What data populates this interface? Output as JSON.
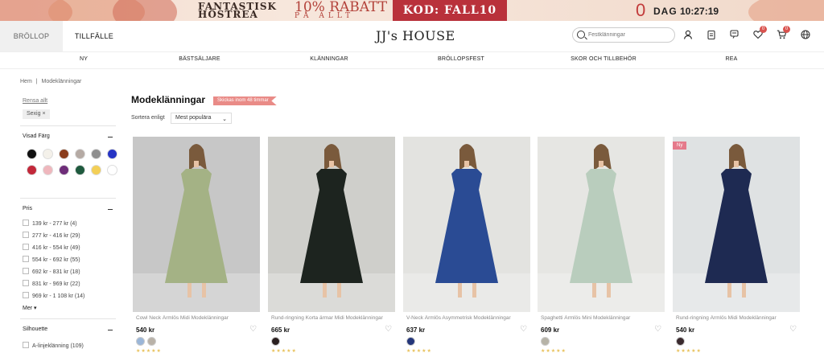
{
  "promo": {
    "line1": "FANTASTISK",
    "line2": "HÖSTREA",
    "rabatt_top": "10% RABATT",
    "rabatt_bottom": "PÅ ALLT",
    "code": "KOD: FALL10",
    "count": "0",
    "day": "DAG",
    "time": "10:27:19"
  },
  "header": {
    "tabs": [
      "BRÖLLOP",
      "TILLFÄLLE"
    ],
    "logo": "JJ's HOUSE",
    "search_placeholder": "Festklänningar",
    "wishlist_badge": "0",
    "cart_badge": "0"
  },
  "nav": [
    "NY",
    "BÄSTSÄLJARE",
    "KLÄNNINGAR",
    "BRÖLLOPSFEST",
    "SKOR OCH TILLBEHÖR",
    "REA"
  ],
  "breadcrumb": {
    "home": "Hem",
    "sep": "|",
    "current": "Modeklänningar"
  },
  "sidebar": {
    "clear_all": "Rensa allt",
    "active_filter": "Sexig ×",
    "color_title": "Visad Färg",
    "colors": [
      "#111111",
      "#f4f1ea",
      "#8a3d1c",
      "#b5aaa4",
      "#8f8f8f",
      "#2634c4",
      "#c2283a",
      "#efb7bd",
      "#6e2d79",
      "#1f5a3e",
      "#f3cf57",
      "#ffffff"
    ],
    "price_title": "Pris",
    "prices": [
      "139 kr - 277 kr (4)",
      "277 kr - 416 kr (29)",
      "416 kr - 554 kr (49)",
      "554 kr - 692 kr (55)",
      "692 kr - 831 kr (18)",
      "831 kr - 969 kr (22)",
      "969 kr - 1 108 kr (14)"
    ],
    "more": "Mer ▾",
    "silhouette_title": "Silhouette",
    "silhouette_first": "A-linjeklänning (109)"
  },
  "main": {
    "title": "Modeklänningar",
    "ship_tag": "Skickas inom 48 timmar",
    "sort_label": "Sortera enligt",
    "sort_value": "Mest populära"
  },
  "products": [
    {
      "name": "Cowl Neck Ärmlös Midi Modeklänningar",
      "price": "540 kr",
      "dress": "#a4b285",
      "bg": "#c7c7c7",
      "dots": [
        "#9bb6d8",
        "#b9b2a8"
      ],
      "new": ""
    },
    {
      "name": "Rund-ringning Korta ärmar Midi Modeklänningar",
      "price": "665 kr",
      "dress": "#1d241f",
      "bg": "#cfcfcb",
      "dots": [
        "#2a1f1f"
      ],
      "new": ""
    },
    {
      "name": "V-Neck Ärmlös Asymmetrisk Modeklänningar",
      "price": "637 kr",
      "dress": "#2a4b94",
      "bg": "#e3e3e0",
      "dots": [
        "#24367a"
      ],
      "new": ""
    },
    {
      "name": "Spaghetti Ärmlös Mini Modeklänningar",
      "price": "609 kr",
      "dress": "#b9cdbd",
      "bg": "#e6e6e3",
      "dots": [
        "#b6b3a7"
      ],
      "new": ""
    },
    {
      "name": "Rund-ringning Ärmlös Midi Modeklänningar",
      "price": "540 kr",
      "dress": "#1e2a52",
      "bg": "#dfe2e3",
      "dots": [
        "#3a2a2e"
      ],
      "new": "Ny"
    }
  ]
}
